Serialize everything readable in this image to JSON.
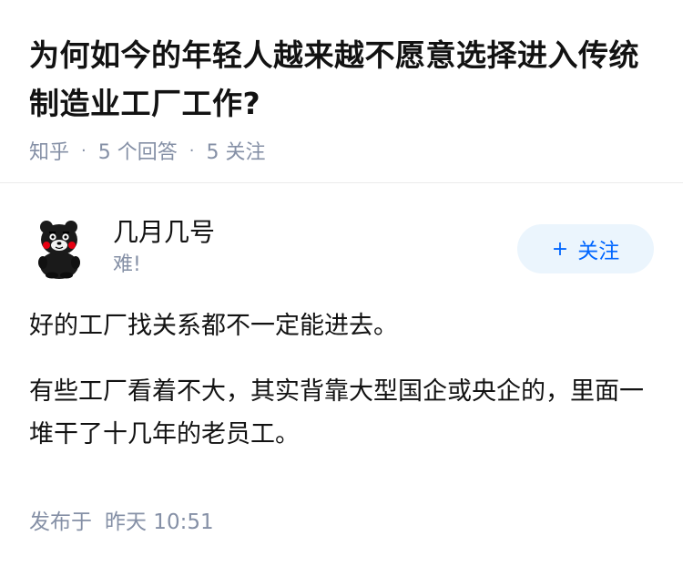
{
  "question": {
    "title": "为何如今的年轻人越来越不愿意选择进入传统制造业工厂工作?",
    "source": "知乎",
    "separator": "·",
    "answers_count": "5 个回答",
    "followers_count": "5 关注"
  },
  "answer": {
    "author_name": "几月几号",
    "author_bio": "难!",
    "follow_label": "关注",
    "follow_plus": "+",
    "paragraphs": [
      "好的工厂找关系都不一定能进去。",
      "有些工厂看着不大，其实背靠大型国企或央企的，里面一堆干了十几年的老员工。"
    ],
    "published_prefix": "发布于",
    "published_time": "昨天 10:51"
  },
  "colors": {
    "meta_gray": "#8590a6",
    "follow_bg": "#ebf5fd",
    "follow_text": "#0066ff"
  },
  "icons": {
    "avatar": "kumamon-bear-avatar"
  }
}
